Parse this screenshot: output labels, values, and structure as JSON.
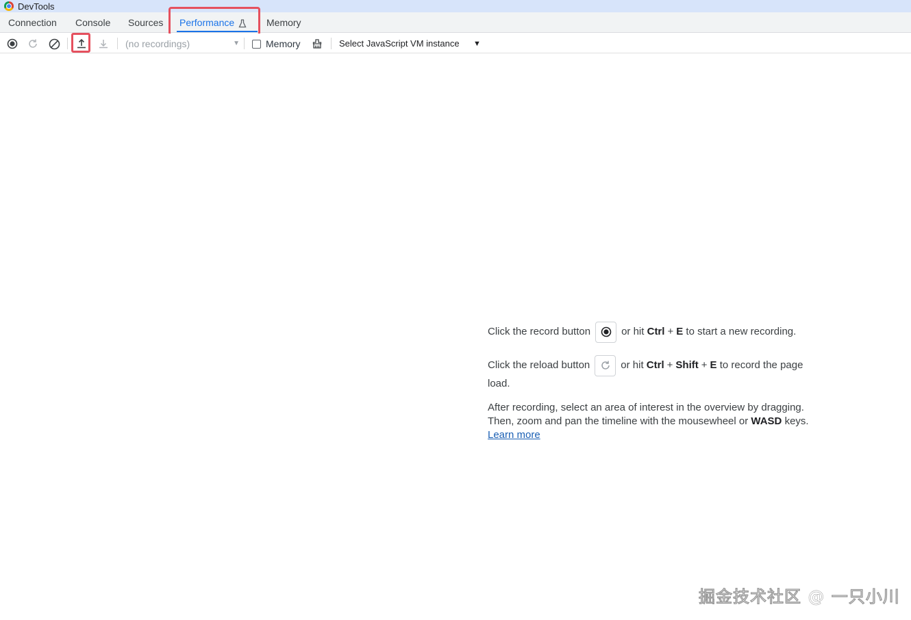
{
  "window": {
    "title": "DevTools"
  },
  "tabs": [
    {
      "label": "Connection"
    },
    {
      "label": "Console"
    },
    {
      "label": "Sources"
    },
    {
      "label": "Performance",
      "active": true
    },
    {
      "label": "Memory"
    }
  ],
  "toolbar": {
    "recordings_placeholder": "(no recordings)",
    "memory_checkbox": {
      "label": "Memory",
      "checked": false
    },
    "vm_select": "Select JavaScript VM instance",
    "icons": [
      "record-icon",
      "reload-icon",
      "clear-icon",
      "upload-icon",
      "download-icon",
      "garbage-collect-icon"
    ]
  },
  "landing": {
    "record": {
      "prefix": "Click the record button",
      "or_hit": "or hit",
      "key1": "Ctrl",
      "plus": "+",
      "key2": "E",
      "suffix": "to start a new recording."
    },
    "reload": {
      "prefix": "Click the reload button",
      "or_hit": "or hit",
      "key1": "Ctrl",
      "key2": "Shift",
      "key3": "E",
      "suffix": "to record the page",
      "suffix2": "load."
    },
    "after1": "After recording, select an area of interest in the overview by dragging.",
    "after2_prefix": "Then, zoom and pan the timeline with the mousewheel or",
    "after2_keys": "WASD",
    "after2_suffix": "keys.",
    "learn_more": "Learn more"
  },
  "watermark": "掘金技术社区 @ 一只小川",
  "colors": {
    "accent": "#1a73e8",
    "highlight": "#e5505e",
    "titlebar": "#d7e4fa"
  }
}
